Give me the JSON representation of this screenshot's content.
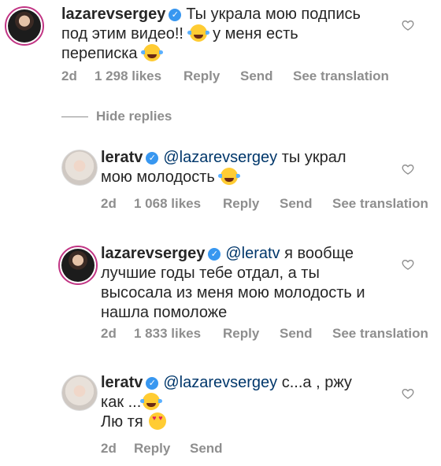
{
  "comments": [
    {
      "username": "lazarevsergey",
      "line1": "Ты украла мою подпись",
      "line2": "под этим видео!! ",
      "line2b": " у меня есть",
      "line3": "переписка ",
      "time": "2d",
      "likes": "1 298 likes",
      "reply": "Reply",
      "send": "Send",
      "translate": "See translation"
    },
    {
      "username": "leratv",
      "mention": "@lazarevsergey",
      "line1": " ты украл",
      "line2": "мою молодость ",
      "time": "2d",
      "likes": "1 068 likes",
      "reply": "Reply",
      "send": "Send",
      "translate": "See translation"
    },
    {
      "username": "lazarevsergey",
      "mention": "@leratv",
      "line1": " я вообще",
      "line2": "лучшие годы тебе отдал, а ты",
      "line3": "высосала из меня мою молодость и",
      "line4": "нашла помоложе",
      "time": "2d",
      "likes": "1 833 likes",
      "reply": "Reply",
      "send": "Send",
      "translate": "See translation"
    },
    {
      "username": "leratv",
      "mention": "@lazarevsergey",
      "line1": " с...а , ржу",
      "line2": "как ...",
      "line3": "Лю тя ",
      "time": "2d",
      "reply": "Reply",
      "send": "Send"
    }
  ],
  "hide_replies": "Hide replies",
  "icons": {
    "verified": "verified-badge-icon",
    "like": "heart-outline-icon",
    "emoji_joy": "face-with-tears-of-joy-emoji",
    "emoji_heart_eyes": "heart-eyes-emoji"
  },
  "colors": {
    "verified": "#3897f0",
    "mention": "#00376b",
    "meta": "#8e8e8e",
    "story_ring": "#c13584"
  }
}
